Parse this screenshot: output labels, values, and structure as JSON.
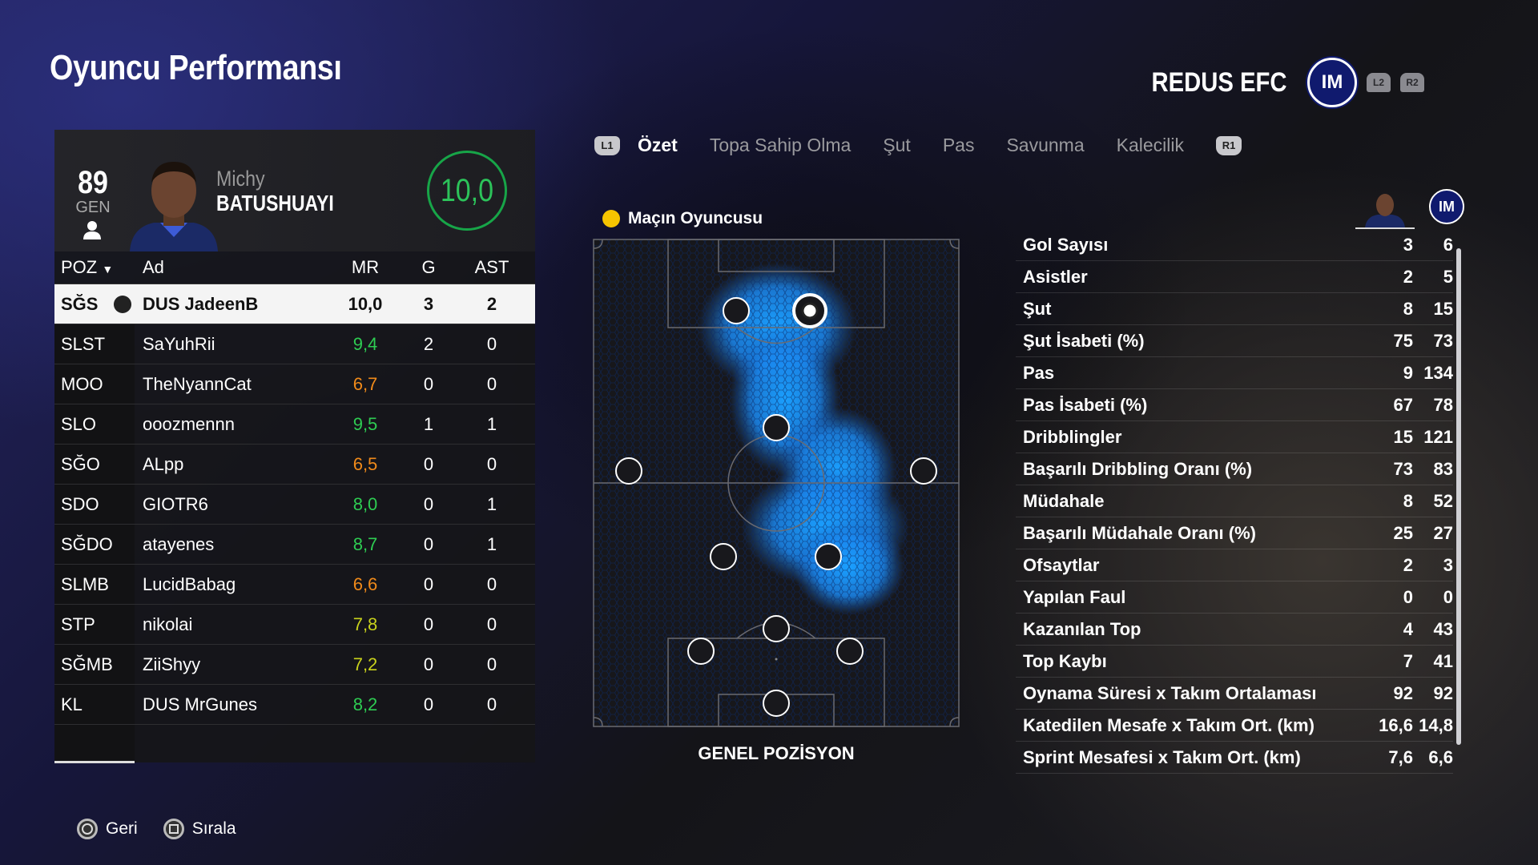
{
  "header": {
    "title": "Oyuncu Performansı",
    "club_name": "REDUS EFC",
    "club_badge_icon": "inter-badge-icon",
    "l2": "L2",
    "r2": "R2"
  },
  "player": {
    "overall": "89",
    "overall_label": "GEN",
    "first_name": "Michy",
    "last_name": "BATUSHUAYI",
    "rating": "10,0"
  },
  "table": {
    "headers": {
      "pos": "POZ",
      "name": "Ad",
      "mr": "MR",
      "g": "G",
      "ast": "AST"
    },
    "rows": [
      {
        "pos": "SĞS",
        "name": "DUS JadeenB",
        "mr": "10,0",
        "g": "3",
        "ast": "2",
        "selected": true
      },
      {
        "pos": "SLST",
        "name": "SaYuhRii",
        "mr": "9,4",
        "g": "2",
        "ast": "0",
        "color": "#2ecc52"
      },
      {
        "pos": "MOO",
        "name": "TheNyannCat",
        "mr": "6,7",
        "g": "0",
        "ast": "0",
        "color": "#f08a1a"
      },
      {
        "pos": "SLO",
        "name": "ooozmennn",
        "mr": "9,5",
        "g": "1",
        "ast": "1",
        "color": "#2ecc52"
      },
      {
        "pos": "SĞO",
        "name": "ALpp",
        "mr": "6,5",
        "g": "0",
        "ast": "0",
        "color": "#f08a1a"
      },
      {
        "pos": "SDO",
        "name": "GIOTR6",
        "mr": "8,0",
        "g": "0",
        "ast": "1",
        "color": "#2ecc52"
      },
      {
        "pos": "SĞDO",
        "name": "atayenes",
        "mr": "8,7",
        "g": "0",
        "ast": "1",
        "color": "#2ecc52"
      },
      {
        "pos": "SLMB",
        "name": "LucidBabag",
        "mr": "6,6",
        "g": "0",
        "ast": "0",
        "color": "#f08a1a"
      },
      {
        "pos": "STP",
        "name": "nikolai",
        "mr": "7,8",
        "g": "0",
        "ast": "0",
        "color": "#c9d21c"
      },
      {
        "pos": "SĞMB",
        "name": "ZiiShyy",
        "mr": "7,2",
        "g": "0",
        "ast": "0",
        "color": "#c9d21c"
      },
      {
        "pos": "KL",
        "name": "DUS MrGunes",
        "mr": "8,2",
        "g": "0",
        "ast": "0",
        "color": "#2ecc52"
      }
    ]
  },
  "tabs": {
    "l1": "L1",
    "r1": "R1",
    "items": [
      "Özet",
      "Topa Sahip Olma",
      "Şut",
      "Pas",
      "Savunma",
      "Kalecilik"
    ]
  },
  "pitch": {
    "motm_label": "Maçın Oyuncusu",
    "position_label": "GENEL POZİSYON"
  },
  "stats": [
    {
      "label": "Gol Sayısı",
      "player": "3",
      "team": "6"
    },
    {
      "label": "Asistler",
      "player": "2",
      "team": "5"
    },
    {
      "label": "Şut",
      "player": "8",
      "team": "15"
    },
    {
      "label": "Şut İsabeti (%)",
      "player": "75",
      "team": "73"
    },
    {
      "label": "Pas",
      "player": "9",
      "team": "134"
    },
    {
      "label": "Pas İsabeti (%)",
      "player": "67",
      "team": "78"
    },
    {
      "label": "Dribblingler",
      "player": "15",
      "team": "121"
    },
    {
      "label": "Başarılı Dribbling Oranı (%)",
      "player": "73",
      "team": "83"
    },
    {
      "label": "Müdahale",
      "player": "8",
      "team": "52"
    },
    {
      "label": "Başarılı Müdahale Oranı (%)",
      "player": "25",
      "team": "27"
    },
    {
      "label": "Ofsaytlar",
      "player": "2",
      "team": "3"
    },
    {
      "label": "Yapılan Faul",
      "player": "0",
      "team": "0"
    },
    {
      "label": "Kazanılan Top",
      "player": "4",
      "team": "43"
    },
    {
      "label": "Top Kaybı",
      "player": "7",
      "team": "41"
    },
    {
      "label": "Oynama Süresi x Takım Ortalaması",
      "player": "92",
      "team": "92"
    },
    {
      "label": "Katedilen Mesafe x Takım Ort. (km)",
      "player": "16,6",
      "team": "14,8"
    },
    {
      "label": "Sprint Mesafesi x Takım Ort. (km)",
      "player": "7,6",
      "team": "6,6"
    }
  ],
  "footer": {
    "back": "Geri",
    "sort": "Sırala"
  }
}
